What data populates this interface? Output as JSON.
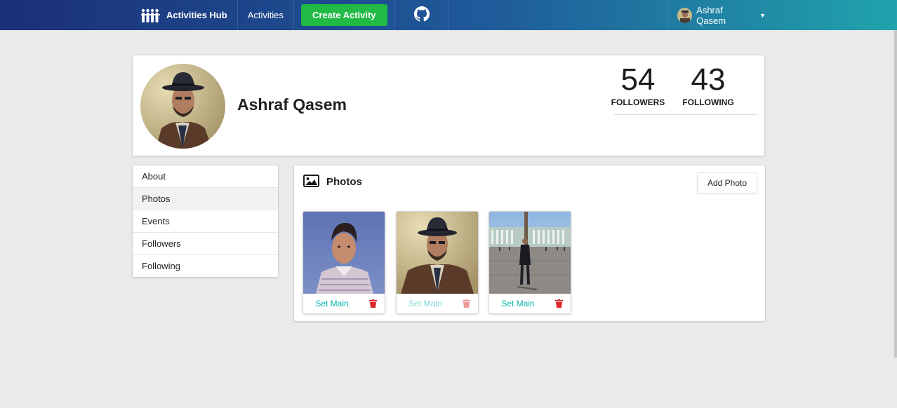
{
  "navbar": {
    "brand": "Activities Hub",
    "activities_link": "Activities",
    "create_activity": "Create Activity",
    "user_name": "Ashraf Qasem"
  },
  "profile": {
    "name": "Ashraf Qasem",
    "followers_count": "54",
    "followers_label": "FOLLOWERS",
    "following_count": "43",
    "following_label": "FOLLOWING"
  },
  "side_menu": {
    "items": [
      {
        "label": "About"
      },
      {
        "label": "Photos"
      },
      {
        "label": "Events"
      },
      {
        "label": "Followers"
      },
      {
        "label": "Following"
      }
    ],
    "active": "Photos"
  },
  "photos": {
    "title": "Photos",
    "add_button": "Add Photo",
    "items": [
      {
        "set_main_label": "Set Main",
        "is_main": false
      },
      {
        "set_main_label": "Set Main",
        "is_main": true
      },
      {
        "set_main_label": "Set Main",
        "is_main": false
      }
    ]
  },
  "colors": {
    "nav_gradient_start": "#1b2f7a",
    "nav_gradient_end": "#20a3ac",
    "create_button": "#21ba45",
    "teal_text": "#00b5ad",
    "trash_red": "#db2828"
  },
  "icons": [
    "users-logo-icon",
    "github-icon",
    "caret-down-icon",
    "image-icon",
    "trash-icon"
  ]
}
